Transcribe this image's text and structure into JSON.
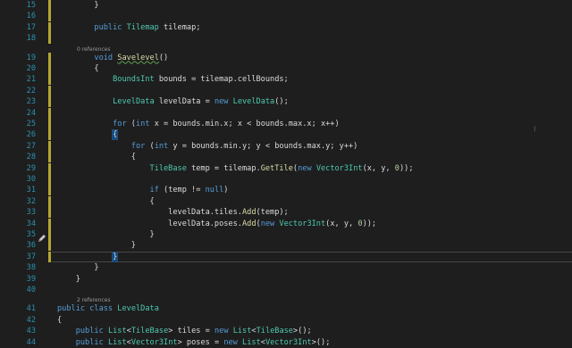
{
  "lines": [
    {
      "n": "15",
      "code": [
        {
          "t": "pl",
          "s": "        }"
        }
      ]
    },
    {
      "n": "16",
      "code": []
    },
    {
      "n": "17",
      "code": [
        {
          "t": "pl",
          "s": "        "
        },
        {
          "t": "kw",
          "s": "public"
        },
        {
          "t": "pl",
          "s": " "
        },
        {
          "t": "ty",
          "s": "Tilemap"
        },
        {
          "t": "pl",
          "s": " tilemap;"
        }
      ]
    },
    {
      "n": "18",
      "code": []
    },
    {
      "n": "19",
      "code": [
        {
          "t": "pl",
          "s": "        "
        },
        {
          "t": "kw",
          "s": "void"
        },
        {
          "t": "pl",
          "s": " "
        },
        {
          "t": "fn",
          "s": "Savelevel"
        },
        {
          "t": "pl",
          "s": "()"
        }
      ]
    },
    {
      "n": "20",
      "code": [
        {
          "t": "pl",
          "s": "        {"
        }
      ]
    },
    {
      "n": "21",
      "code": [
        {
          "t": "pl",
          "s": "            "
        },
        {
          "t": "ty",
          "s": "BoundsInt"
        },
        {
          "t": "pl",
          "s": " bounds = tilemap.cellBounds;"
        }
      ]
    },
    {
      "n": "22",
      "code": []
    },
    {
      "n": "23",
      "code": [
        {
          "t": "pl",
          "s": "            "
        },
        {
          "t": "ty",
          "s": "LevelData"
        },
        {
          "t": "pl",
          "s": " levelData = "
        },
        {
          "t": "kw",
          "s": "new"
        },
        {
          "t": "pl",
          "s": " "
        },
        {
          "t": "ty",
          "s": "LevelData"
        },
        {
          "t": "pl",
          "s": "();"
        }
      ]
    },
    {
      "n": "24",
      "code": []
    },
    {
      "n": "25",
      "code": [
        {
          "t": "pl",
          "s": "            "
        },
        {
          "t": "kw",
          "s": "for"
        },
        {
          "t": "pl",
          "s": " ("
        },
        {
          "t": "kw",
          "s": "int"
        },
        {
          "t": "pl",
          "s": " x = bounds.min.x; x < bounds.max.x; x++)"
        }
      ]
    },
    {
      "n": "26",
      "code": [
        {
          "t": "pl",
          "s": "            "
        },
        {
          "t": "hl",
          "s": "{"
        }
      ]
    },
    {
      "n": "27",
      "code": [
        {
          "t": "pl",
          "s": "                "
        },
        {
          "t": "kw",
          "s": "for"
        },
        {
          "t": "pl",
          "s": " ("
        },
        {
          "t": "kw",
          "s": "int"
        },
        {
          "t": "pl",
          "s": " y = bounds.min.y; y < bounds.max.y; y++)"
        }
      ]
    },
    {
      "n": "28",
      "code": [
        {
          "t": "pl",
          "s": "                {"
        }
      ]
    },
    {
      "n": "29",
      "code": [
        {
          "t": "pl",
          "s": "                    "
        },
        {
          "t": "ty",
          "s": "TileBase"
        },
        {
          "t": "pl",
          "s": " temp = tilemap."
        },
        {
          "t": "fn",
          "s": "GetTile"
        },
        {
          "t": "pl",
          "s": "("
        },
        {
          "t": "kw",
          "s": "new"
        },
        {
          "t": "pl",
          "s": " "
        },
        {
          "t": "ty",
          "s": "Vector3Int"
        },
        {
          "t": "pl",
          "s": "(x, y, "
        },
        {
          "t": "nm",
          "s": "0"
        },
        {
          "t": "pl",
          "s": "));"
        }
      ]
    },
    {
      "n": "30",
      "code": []
    },
    {
      "n": "31",
      "code": [
        {
          "t": "pl",
          "s": "                    "
        },
        {
          "t": "kw",
          "s": "if"
        },
        {
          "t": "pl",
          "s": " (temp != "
        },
        {
          "t": "kw",
          "s": "null"
        },
        {
          "t": "pl",
          "s": ")"
        }
      ]
    },
    {
      "n": "32",
      "code": [
        {
          "t": "pl",
          "s": "                    {"
        }
      ]
    },
    {
      "n": "33",
      "code": [
        {
          "t": "pl",
          "s": "                        levelData.tiles."
        },
        {
          "t": "fn",
          "s": "Add"
        },
        {
          "t": "pl",
          "s": "(temp);"
        }
      ]
    },
    {
      "n": "34",
      "code": [
        {
          "t": "pl",
          "s": "                        levelData.poses."
        },
        {
          "t": "fn",
          "s": "Add"
        },
        {
          "t": "pl",
          "s": "("
        },
        {
          "t": "kw",
          "s": "new"
        },
        {
          "t": "pl",
          "s": " "
        },
        {
          "t": "ty",
          "s": "Vector3Int"
        },
        {
          "t": "pl",
          "s": "(x, y, "
        },
        {
          "t": "nm",
          "s": "0"
        },
        {
          "t": "pl",
          "s": "));"
        }
      ]
    },
    {
      "n": "35",
      "code": [
        {
          "t": "pl",
          "s": "                    }"
        }
      ]
    },
    {
      "n": "36",
      "code": [
        {
          "t": "pl",
          "s": "                }"
        }
      ]
    },
    {
      "n": "37",
      "code": [
        {
          "t": "pl",
          "s": "            "
        },
        {
          "t": "hl",
          "s": "}"
        }
      ]
    },
    {
      "n": "38",
      "code": [
        {
          "t": "pl",
          "s": "        }"
        }
      ]
    },
    {
      "n": "39",
      "code": [
        {
          "t": "pl",
          "s": "    }"
        }
      ]
    },
    {
      "n": "40",
      "code": []
    },
    {
      "n": "41",
      "code": [
        {
          "t": "kw",
          "s": "public"
        },
        {
          "t": "pl",
          "s": " "
        },
        {
          "t": "kw",
          "s": "class"
        },
        {
          "t": "pl",
          "s": " "
        },
        {
          "t": "ty",
          "s": "LevelData"
        }
      ]
    },
    {
      "n": "42",
      "code": [
        {
          "t": "pl",
          "s": "{"
        }
      ]
    },
    {
      "n": "43",
      "code": [
        {
          "t": "pl",
          "s": "    "
        },
        {
          "t": "kw",
          "s": "public"
        },
        {
          "t": "pl",
          "s": " "
        },
        {
          "t": "ty",
          "s": "List"
        },
        {
          "t": "pl",
          "s": "<"
        },
        {
          "t": "ty",
          "s": "TileBase"
        },
        {
          "t": "pl",
          "s": "> tiles = "
        },
        {
          "t": "kw",
          "s": "new"
        },
        {
          "t": "pl",
          "s": " "
        },
        {
          "t": "ty",
          "s": "List"
        },
        {
          "t": "pl",
          "s": "<"
        },
        {
          "t": "ty",
          "s": "TileBase"
        },
        {
          "t": "pl",
          "s": ">();"
        }
      ]
    },
    {
      "n": "44",
      "code": [
        {
          "t": "pl",
          "s": "    "
        },
        {
          "t": "kw",
          "s": "public"
        },
        {
          "t": "pl",
          "s": " "
        },
        {
          "t": "ty",
          "s": "List"
        },
        {
          "t": "pl",
          "s": "<"
        },
        {
          "t": "ty",
          "s": "Vector3Int"
        },
        {
          "t": "pl",
          "s": "> poses = "
        },
        {
          "t": "kw",
          "s": "new"
        },
        {
          "t": "pl",
          "s": " "
        },
        {
          "t": "ty",
          "s": "List"
        },
        {
          "t": "pl",
          "s": "<"
        },
        {
          "t": "ty",
          "s": "Vector3Int"
        },
        {
          "t": "pl",
          "s": ">();"
        }
      ]
    }
  ],
  "references": [
    {
      "before_line": "19",
      "text": "0 references"
    },
    {
      "before_line": "41",
      "text": "2 references"
    }
  ],
  "modified_lines": [
    "15",
    "16",
    "17",
    "18",
    "19",
    "20",
    "21",
    "22",
    "23",
    "24",
    "25",
    "26",
    "27",
    "28",
    "29",
    "30",
    "31",
    "32",
    "33",
    "34",
    "35",
    "36",
    "37"
  ],
  "current_line": "37",
  "colors": {
    "background": "#1e1e1e",
    "keyword": "#569cd6",
    "type": "#4ec9b0",
    "method": "#dcdcaa",
    "line_number": "#2b91af",
    "modified": "#b5a632"
  }
}
